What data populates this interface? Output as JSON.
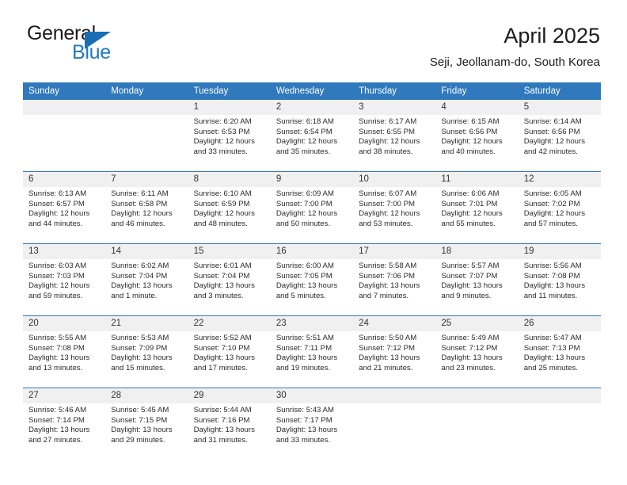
{
  "brand": {
    "word_one": "General",
    "word_two": "Blue",
    "triangle_color": "#1b6db5",
    "blue_text_color": "#2079c7"
  },
  "header": {
    "title": "April 2025",
    "subtitle": "Seji, Jeollanam-do, South Korea"
  },
  "theme": {
    "header_row_bg": "#3079bd",
    "daynum_bg": "#f0f0f0",
    "grid_line": "#3079bd",
    "text": "#2b2b2b"
  },
  "weekday_headers": [
    "Sunday",
    "Monday",
    "Tuesday",
    "Wednesday",
    "Thursday",
    "Friday",
    "Saturday"
  ],
  "labels": {
    "sunrise_prefix": "Sunrise:",
    "sunset_prefix": "Sunset:",
    "daylight_prefix": "Daylight:"
  },
  "weeks": [
    [
      {
        "day": "",
        "sunrise": "",
        "sunset": "",
        "daylight_line1": "",
        "daylight_line2": ""
      },
      {
        "day": "",
        "sunrise": "",
        "sunset": "",
        "daylight_line1": "",
        "daylight_line2": ""
      },
      {
        "day": "1",
        "sunrise": "Sunrise: 6:20 AM",
        "sunset": "Sunset: 6:53 PM",
        "daylight_line1": "Daylight: 12 hours",
        "daylight_line2": "and 33 minutes."
      },
      {
        "day": "2",
        "sunrise": "Sunrise: 6:18 AM",
        "sunset": "Sunset: 6:54 PM",
        "daylight_line1": "Daylight: 12 hours",
        "daylight_line2": "and 35 minutes."
      },
      {
        "day": "3",
        "sunrise": "Sunrise: 6:17 AM",
        "sunset": "Sunset: 6:55 PM",
        "daylight_line1": "Daylight: 12 hours",
        "daylight_line2": "and 38 minutes."
      },
      {
        "day": "4",
        "sunrise": "Sunrise: 6:15 AM",
        "sunset": "Sunset: 6:56 PM",
        "daylight_line1": "Daylight: 12 hours",
        "daylight_line2": "and 40 minutes."
      },
      {
        "day": "5",
        "sunrise": "Sunrise: 6:14 AM",
        "sunset": "Sunset: 6:56 PM",
        "daylight_line1": "Daylight: 12 hours",
        "daylight_line2": "and 42 minutes."
      }
    ],
    [
      {
        "day": "6",
        "sunrise": "Sunrise: 6:13 AM",
        "sunset": "Sunset: 6:57 PM",
        "daylight_line1": "Daylight: 12 hours",
        "daylight_line2": "and 44 minutes."
      },
      {
        "day": "7",
        "sunrise": "Sunrise: 6:11 AM",
        "sunset": "Sunset: 6:58 PM",
        "daylight_line1": "Daylight: 12 hours",
        "daylight_line2": "and 46 minutes."
      },
      {
        "day": "8",
        "sunrise": "Sunrise: 6:10 AM",
        "sunset": "Sunset: 6:59 PM",
        "daylight_line1": "Daylight: 12 hours",
        "daylight_line2": "and 48 minutes."
      },
      {
        "day": "9",
        "sunrise": "Sunrise: 6:09 AM",
        "sunset": "Sunset: 7:00 PM",
        "daylight_line1": "Daylight: 12 hours",
        "daylight_line2": "and 50 minutes."
      },
      {
        "day": "10",
        "sunrise": "Sunrise: 6:07 AM",
        "sunset": "Sunset: 7:00 PM",
        "daylight_line1": "Daylight: 12 hours",
        "daylight_line2": "and 53 minutes."
      },
      {
        "day": "11",
        "sunrise": "Sunrise: 6:06 AM",
        "sunset": "Sunset: 7:01 PM",
        "daylight_line1": "Daylight: 12 hours",
        "daylight_line2": "and 55 minutes."
      },
      {
        "day": "12",
        "sunrise": "Sunrise: 6:05 AM",
        "sunset": "Sunset: 7:02 PM",
        "daylight_line1": "Daylight: 12 hours",
        "daylight_line2": "and 57 minutes."
      }
    ],
    [
      {
        "day": "13",
        "sunrise": "Sunrise: 6:03 AM",
        "sunset": "Sunset: 7:03 PM",
        "daylight_line1": "Daylight: 12 hours",
        "daylight_line2": "and 59 minutes."
      },
      {
        "day": "14",
        "sunrise": "Sunrise: 6:02 AM",
        "sunset": "Sunset: 7:04 PM",
        "daylight_line1": "Daylight: 13 hours",
        "daylight_line2": "and 1 minute."
      },
      {
        "day": "15",
        "sunrise": "Sunrise: 6:01 AM",
        "sunset": "Sunset: 7:04 PM",
        "daylight_line1": "Daylight: 13 hours",
        "daylight_line2": "and 3 minutes."
      },
      {
        "day": "16",
        "sunrise": "Sunrise: 6:00 AM",
        "sunset": "Sunset: 7:05 PM",
        "daylight_line1": "Daylight: 13 hours",
        "daylight_line2": "and 5 minutes."
      },
      {
        "day": "17",
        "sunrise": "Sunrise: 5:58 AM",
        "sunset": "Sunset: 7:06 PM",
        "daylight_line1": "Daylight: 13 hours",
        "daylight_line2": "and 7 minutes."
      },
      {
        "day": "18",
        "sunrise": "Sunrise: 5:57 AM",
        "sunset": "Sunset: 7:07 PM",
        "daylight_line1": "Daylight: 13 hours",
        "daylight_line2": "and 9 minutes."
      },
      {
        "day": "19",
        "sunrise": "Sunrise: 5:56 AM",
        "sunset": "Sunset: 7:08 PM",
        "daylight_line1": "Daylight: 13 hours",
        "daylight_line2": "and 11 minutes."
      }
    ],
    [
      {
        "day": "20",
        "sunrise": "Sunrise: 5:55 AM",
        "sunset": "Sunset: 7:08 PM",
        "daylight_line1": "Daylight: 13 hours",
        "daylight_line2": "and 13 minutes."
      },
      {
        "day": "21",
        "sunrise": "Sunrise: 5:53 AM",
        "sunset": "Sunset: 7:09 PM",
        "daylight_line1": "Daylight: 13 hours",
        "daylight_line2": "and 15 minutes."
      },
      {
        "day": "22",
        "sunrise": "Sunrise: 5:52 AM",
        "sunset": "Sunset: 7:10 PM",
        "daylight_line1": "Daylight: 13 hours",
        "daylight_line2": "and 17 minutes."
      },
      {
        "day": "23",
        "sunrise": "Sunrise: 5:51 AM",
        "sunset": "Sunset: 7:11 PM",
        "daylight_line1": "Daylight: 13 hours",
        "daylight_line2": "and 19 minutes."
      },
      {
        "day": "24",
        "sunrise": "Sunrise: 5:50 AM",
        "sunset": "Sunset: 7:12 PM",
        "daylight_line1": "Daylight: 13 hours",
        "daylight_line2": "and 21 minutes."
      },
      {
        "day": "25",
        "sunrise": "Sunrise: 5:49 AM",
        "sunset": "Sunset: 7:12 PM",
        "daylight_line1": "Daylight: 13 hours",
        "daylight_line2": "and 23 minutes."
      },
      {
        "day": "26",
        "sunrise": "Sunrise: 5:47 AM",
        "sunset": "Sunset: 7:13 PM",
        "daylight_line1": "Daylight: 13 hours",
        "daylight_line2": "and 25 minutes."
      }
    ],
    [
      {
        "day": "27",
        "sunrise": "Sunrise: 5:46 AM",
        "sunset": "Sunset: 7:14 PM",
        "daylight_line1": "Daylight: 13 hours",
        "daylight_line2": "and 27 minutes."
      },
      {
        "day": "28",
        "sunrise": "Sunrise: 5:45 AM",
        "sunset": "Sunset: 7:15 PM",
        "daylight_line1": "Daylight: 13 hours",
        "daylight_line2": "and 29 minutes."
      },
      {
        "day": "29",
        "sunrise": "Sunrise: 5:44 AM",
        "sunset": "Sunset: 7:16 PM",
        "daylight_line1": "Daylight: 13 hours",
        "daylight_line2": "and 31 minutes."
      },
      {
        "day": "30",
        "sunrise": "Sunrise: 5:43 AM",
        "sunset": "Sunset: 7:17 PM",
        "daylight_line1": "Daylight: 13 hours",
        "daylight_line2": "and 33 minutes."
      },
      {
        "day": "",
        "sunrise": "",
        "sunset": "",
        "daylight_line1": "",
        "daylight_line2": ""
      },
      {
        "day": "",
        "sunrise": "",
        "sunset": "",
        "daylight_line1": "",
        "daylight_line2": ""
      },
      {
        "day": "",
        "sunrise": "",
        "sunset": "",
        "daylight_line1": "",
        "daylight_line2": ""
      }
    ]
  ]
}
